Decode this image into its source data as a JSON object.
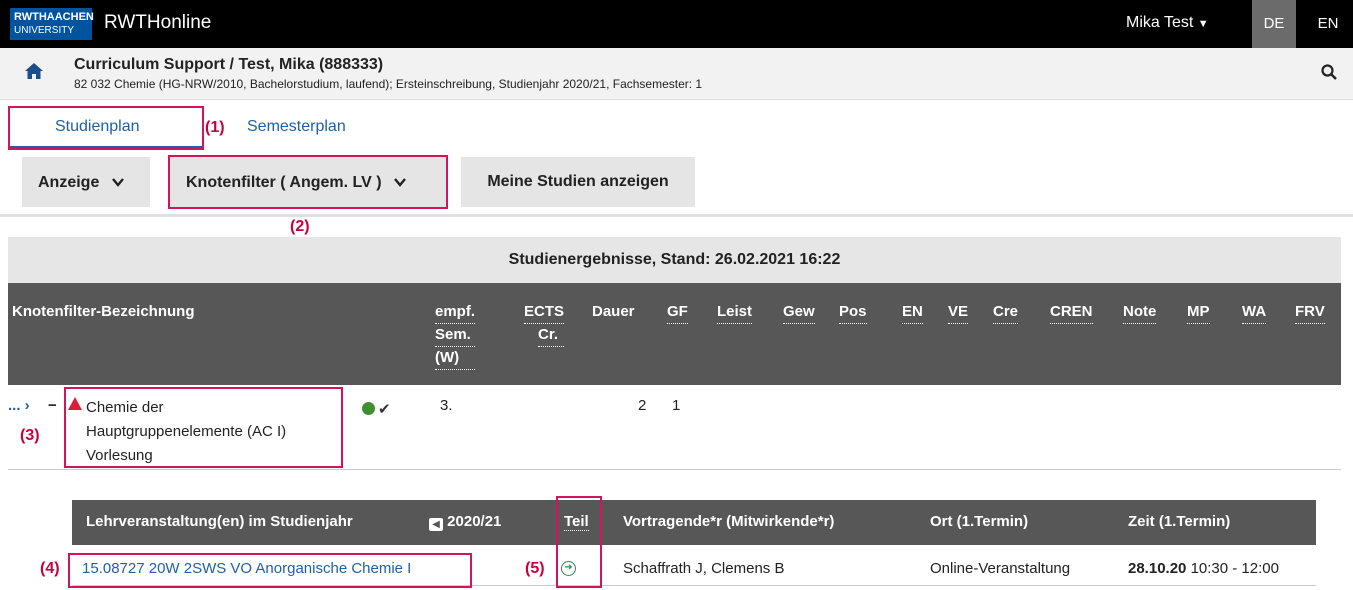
{
  "topbar": {
    "logo_line1": "RWTHAACHEN",
    "logo_line2": "UNIVERSITY",
    "app_title": "RWTHonline",
    "user": "Mika Test",
    "lang_de": "DE",
    "lang_en": "EN"
  },
  "header": {
    "title": "Curriculum Support  / Test, Mika (888333)",
    "subtitle": "82 032 Chemie (HG-NRW/2010, Bachelorstudium, laufend); Ersteinschreibung, Studienjahr 2020/21, Fachsemester: 1"
  },
  "tabs": {
    "studienplan": "Studienplan",
    "semesterplan": "Semesterplan"
  },
  "toolbar": {
    "anzeige": "Anzeige",
    "knotenfilter": "Knotenfilter ( Angem. LV )",
    "meine_studien": "Meine Studien anzeigen"
  },
  "annotations": {
    "a1": "(1)",
    "a2": "(2)",
    "a3": "(3)",
    "a4": "(4)",
    "a5": "(5)"
  },
  "results_bar": "Studienergebnisse, Stand: 26.02.2021 16:22",
  "table": {
    "headers": {
      "name": "Knotenfilter-Bezeichnung",
      "empf_1": "empf.",
      "empf_2": "Sem.",
      "empf_3": "(W)",
      "ects_1": "ECTS",
      "ects_2": "Cr.",
      "dauer": "Dauer",
      "gf": "GF",
      "leist": "Leist",
      "gew": "Gew",
      "pos": "Pos",
      "en": "EN",
      "ve": "VE",
      "cre": "Cre",
      "cren": "CREN",
      "note": "Note",
      "mp": "MP",
      "wa": "WA",
      "frv": "FRV"
    },
    "row": {
      "prefix": "... ›",
      "minus": "−",
      "name_line1": "Chemie der",
      "name_line2": "Hauptgruppenelemente (AC I)",
      "name_line3": "Vorlesung",
      "sem": "3.",
      "dauer": "2",
      "gf": "1"
    }
  },
  "lv_table": {
    "headers": {
      "lehrveranstaltung": "Lehrveranstaltung(en) im Studienjahr",
      "year": "2020/21",
      "teil": "Teil",
      "vortragende": "Vortragende*r (Mitwirkende*r)",
      "ort": "Ort (1.Termin)",
      "zeit": "Zeit (1.Termin)"
    },
    "row": {
      "course": "15.08727 20W 2SWS VO Anorganische Chemie I",
      "vortragende": "Schaffrath J, Clemens B",
      "ort": "Online-Veranstaltung",
      "date": "28.10.20",
      "time": "10:30 - 12:00"
    }
  },
  "colors": {
    "accent": "#1f5fa8",
    "highlight": "#d4145a",
    "header_dark": "#575757"
  }
}
